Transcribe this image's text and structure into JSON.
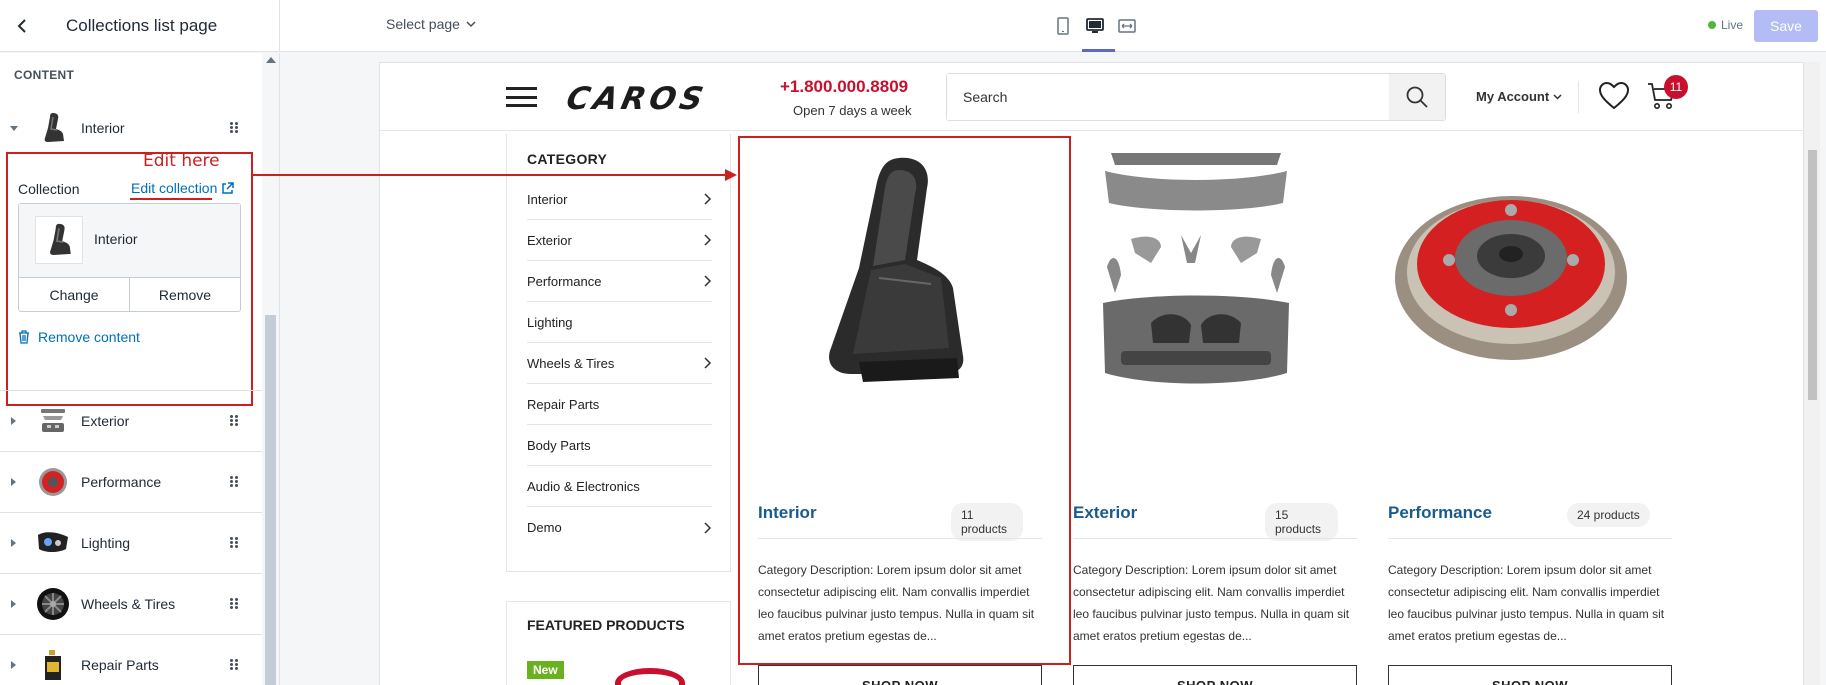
{
  "app": {
    "page_title": "Collections list page",
    "select_page_label": "Select page",
    "live_label": "Live",
    "save_label": "Save"
  },
  "sidebar": {
    "section_heading": "CONTENT",
    "expanded_block": {
      "label": "Interior",
      "collection_label": "Collection",
      "edit_collection_label": "Edit collection",
      "annotation": "Edit here",
      "selected_collection": "Interior",
      "change_label": "Change",
      "remove_label": "Remove",
      "remove_content_label": "Remove content"
    },
    "items": [
      {
        "label": "Exterior"
      },
      {
        "label": "Performance"
      },
      {
        "label": "Lighting"
      },
      {
        "label": "Wheels & Tires"
      },
      {
        "label": "Repair Parts"
      }
    ]
  },
  "store": {
    "logo_text": "CAROS",
    "phone": "+1.800.000.8809",
    "hours": "Open 7 days a week",
    "search_placeholder": "Search",
    "account_label": "My Account",
    "cart_count": "11",
    "category_heading": "CATEGORY",
    "categories": [
      {
        "label": "Interior",
        "has_arrow": true
      },
      {
        "label": "Exterior",
        "has_arrow": true
      },
      {
        "label": "Performance",
        "has_arrow": true
      },
      {
        "label": "Lighting",
        "has_arrow": false
      },
      {
        "label": "Wheels & Tires",
        "has_arrow": true
      },
      {
        "label": "Repair Parts",
        "has_arrow": false
      },
      {
        "label": "Body Parts",
        "has_arrow": false
      },
      {
        "label": "Audio & Electronics",
        "has_arrow": false
      },
      {
        "label": "Demo",
        "has_arrow": true
      }
    ],
    "featured_heading": "FEATURED PRODUCTS",
    "new_badge": "New",
    "collections": [
      {
        "title": "Interior",
        "count": "11 products",
        "description": "Category Description: Lorem ipsum dolor sit amet consectetur adipiscing elit. Nam convallis imperdiet leo faucibus pulvinar justo tempus. Nulla in quam sit amet eratos pretium egestas de...",
        "button": "SHOP NOW"
      },
      {
        "title": "Exterior",
        "count": "15 products",
        "description": "Category Description: Lorem ipsum dolor sit amet consectetur adipiscing elit. Nam convallis imperdiet leo faucibus pulvinar justo tempus. Nulla in quam sit amet eratos pretium egestas de...",
        "button": "SHOP NOW"
      },
      {
        "title": "Performance",
        "count": "24 products",
        "description": "Category Description: Lorem ipsum dolor sit amet consectetur adipiscing elit. Nam convallis imperdiet leo faucibus pulvinar justo tempus. Nulla in quam sit amet eratos pretium egestas de...",
        "button": "SHOP NOW"
      }
    ]
  },
  "colors": {
    "accent": "#5c6ac4",
    "annotation_red": "#cc1f1f",
    "brand_red": "#c8102e",
    "link_blue": "#006fbb",
    "collection_title_blue": "#1a5b8f",
    "live_green": "#50b83c",
    "new_green": "#6ab120"
  }
}
